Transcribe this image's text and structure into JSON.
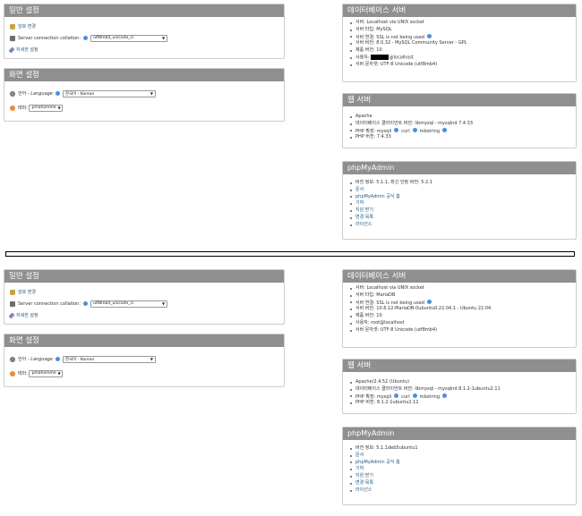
{
  "top": {
    "general": {
      "title": "일반 설정",
      "password_change": "암호 변경",
      "collation_label": "Server connection collation:",
      "collation_value": "utf8mb4_unicode_ci",
      "more_settings": "자세한 설정"
    },
    "appearance": {
      "title": "화면 설정",
      "language_prefix": "언어 -",
      "language_en": "Language",
      "language_value": "한국어 - Korean",
      "theme_label": "테마:",
      "theme_value": "pmahomme"
    },
    "db_server": {
      "title": "데이터베이스 서버",
      "items": [
        "서버: Localhost via UNIX socket",
        "서버 타입: MySQL",
        "서버 연결: SSL is not being used",
        "서버 버전: 8.0.32 - MySQL Community Server - GPL",
        "제품 버전: 10"
      ],
      "user_label": "사용자:",
      "user_suffix": "@localhost",
      "charset": "서버 문자셋: UTF-8 Unicode (utf8mb4)"
    },
    "web_server": {
      "title": "웹 서버",
      "items": [
        "Apache",
        "데이터베이스 클라이언트 버전: libmysql - mysqlnd 7.4.33"
      ],
      "php_ext_label": "PHP 확장: mysqli",
      "php_ext_curl": "curl",
      "php_ext_mb": "mbstring",
      "php_version": "PHP 버전: 7.4.33"
    },
    "pma": {
      "title": "phpMyAdmin",
      "version": "버전 정보: 5.1.1, 최신 안정 버전: 5.2.1",
      "links": [
        "문서",
        "phpMyAdmin 공식 홈",
        "기여",
        "지원 받기",
        "변경 목록",
        "라이선스"
      ]
    }
  },
  "bottom": {
    "general": {
      "title": "일반 설정",
      "password_change": "암호 변경",
      "collation_label": "Server connection collation:",
      "collation_value": "utf8mb4_unicode_ci",
      "more_settings": "자세한 설정"
    },
    "appearance": {
      "title": "화면 설정",
      "language_prefix": "언어 -",
      "language_en": "Language",
      "language_value": "한국어 - Korean",
      "theme_label": "테마:",
      "theme_value": "pmahomme"
    },
    "db_server": {
      "title": "데이터베이스 서버",
      "items": [
        "서버: Localhost via UNIX socket",
        "서버 타입: MariaDB",
        "서버 연결: SSL is not being used",
        "서버 버전: 10.6.12-MariaDB-0ubuntu0.22.04.1 - Ubuntu 22.04",
        "제품 버전: 10",
        "사용자: root@localhost",
        "서버 문자셋: UTF-8 Unicode (utf8mb4)"
      ]
    },
    "web_server": {
      "title": "웹 서버",
      "items": [
        "Apache/2.4.52 (Ubuntu)",
        "데이터베이스 클라이언트 버전: libmysql - mysqlnd 8.1.2-1ubuntu2.11"
      ],
      "php_ext_label": "PHP 확장: mysqli",
      "php_ext_curl": "curl",
      "php_ext_mb": "mbstring",
      "php_version": "PHP 버전: 8.1.2-1ubuntu2.11"
    },
    "pma": {
      "title": "phpMyAdmin",
      "version": "버전 정보: 5.1.1deb5ubuntu1",
      "links": [
        "문서",
        "phpMyAdmin 공식 홈",
        "기여",
        "지원 받기",
        "변경 목록",
        "라이선스"
      ]
    }
  }
}
